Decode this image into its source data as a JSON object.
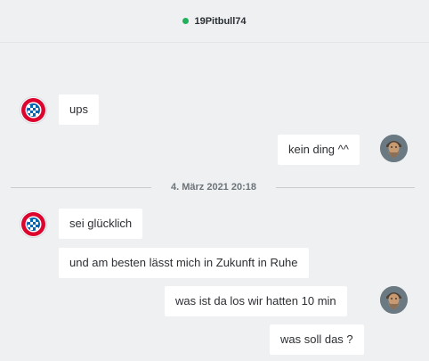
{
  "header": {
    "username": "19Pitbull74",
    "status": "online",
    "status_color": "#20b15a"
  },
  "messages": [
    {
      "text": "ups",
      "side": "left",
      "avatar": "bayern-logo-avatar"
    },
    {
      "text": "kein ding ^^",
      "side": "right",
      "avatar": "dwarf-avatar"
    },
    {
      "text": "sei glücklich",
      "side": "left",
      "avatar": "bayern-logo-avatar"
    },
    {
      "text": "und am besten lässt mich in Zukunft in Ruhe",
      "side": "left"
    },
    {
      "text": "was ist da los wir hatten 10 min",
      "side": "right",
      "avatar": "dwarf-avatar"
    },
    {
      "text": "was soll das ?",
      "side": "right"
    }
  ],
  "date_separator": "4. März 2021 20:18"
}
